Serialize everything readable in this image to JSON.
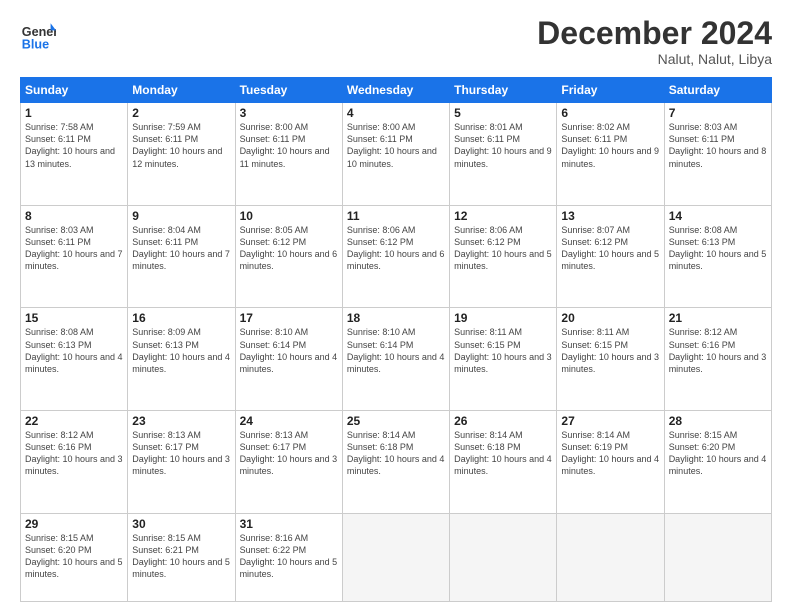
{
  "logo": {
    "line1": "General",
    "line2": "Blue"
  },
  "title": "December 2024",
  "subtitle": "Nalut, Nalut, Libya",
  "days_of_week": [
    "Sunday",
    "Monday",
    "Tuesday",
    "Wednesday",
    "Thursday",
    "Friday",
    "Saturday"
  ],
  "weeks": [
    [
      {
        "day": 1,
        "sunrise": "7:58 AM",
        "sunset": "6:11 PM",
        "daylight": "10 hours and 13 minutes."
      },
      {
        "day": 2,
        "sunrise": "7:59 AM",
        "sunset": "6:11 PM",
        "daylight": "10 hours and 12 minutes."
      },
      {
        "day": 3,
        "sunrise": "8:00 AM",
        "sunset": "6:11 PM",
        "daylight": "10 hours and 11 minutes."
      },
      {
        "day": 4,
        "sunrise": "8:00 AM",
        "sunset": "6:11 PM",
        "daylight": "10 hours and 10 minutes."
      },
      {
        "day": 5,
        "sunrise": "8:01 AM",
        "sunset": "6:11 PM",
        "daylight": "10 hours and 9 minutes."
      },
      {
        "day": 6,
        "sunrise": "8:02 AM",
        "sunset": "6:11 PM",
        "daylight": "10 hours and 9 minutes."
      },
      {
        "day": 7,
        "sunrise": "8:03 AM",
        "sunset": "6:11 PM",
        "daylight": "10 hours and 8 minutes."
      }
    ],
    [
      {
        "day": 8,
        "sunrise": "8:03 AM",
        "sunset": "6:11 PM",
        "daylight": "10 hours and 7 minutes."
      },
      {
        "day": 9,
        "sunrise": "8:04 AM",
        "sunset": "6:11 PM",
        "daylight": "10 hours and 7 minutes."
      },
      {
        "day": 10,
        "sunrise": "8:05 AM",
        "sunset": "6:12 PM",
        "daylight": "10 hours and 6 minutes."
      },
      {
        "day": 11,
        "sunrise": "8:06 AM",
        "sunset": "6:12 PM",
        "daylight": "10 hours and 6 minutes."
      },
      {
        "day": 12,
        "sunrise": "8:06 AM",
        "sunset": "6:12 PM",
        "daylight": "10 hours and 5 minutes."
      },
      {
        "day": 13,
        "sunrise": "8:07 AM",
        "sunset": "6:12 PM",
        "daylight": "10 hours and 5 minutes."
      },
      {
        "day": 14,
        "sunrise": "8:08 AM",
        "sunset": "6:13 PM",
        "daylight": "10 hours and 5 minutes."
      }
    ],
    [
      {
        "day": 15,
        "sunrise": "8:08 AM",
        "sunset": "6:13 PM",
        "daylight": "10 hours and 4 minutes."
      },
      {
        "day": 16,
        "sunrise": "8:09 AM",
        "sunset": "6:13 PM",
        "daylight": "10 hours and 4 minutes."
      },
      {
        "day": 17,
        "sunrise": "8:10 AM",
        "sunset": "6:14 PM",
        "daylight": "10 hours and 4 minutes."
      },
      {
        "day": 18,
        "sunrise": "8:10 AM",
        "sunset": "6:14 PM",
        "daylight": "10 hours and 4 minutes."
      },
      {
        "day": 19,
        "sunrise": "8:11 AM",
        "sunset": "6:15 PM",
        "daylight": "10 hours and 3 minutes."
      },
      {
        "day": 20,
        "sunrise": "8:11 AM",
        "sunset": "6:15 PM",
        "daylight": "10 hours and 3 minutes."
      },
      {
        "day": 21,
        "sunrise": "8:12 AM",
        "sunset": "6:16 PM",
        "daylight": "10 hours and 3 minutes."
      }
    ],
    [
      {
        "day": 22,
        "sunrise": "8:12 AM",
        "sunset": "6:16 PM",
        "daylight": "10 hours and 3 minutes."
      },
      {
        "day": 23,
        "sunrise": "8:13 AM",
        "sunset": "6:17 PM",
        "daylight": "10 hours and 3 minutes."
      },
      {
        "day": 24,
        "sunrise": "8:13 AM",
        "sunset": "6:17 PM",
        "daylight": "10 hours and 3 minutes."
      },
      {
        "day": 25,
        "sunrise": "8:14 AM",
        "sunset": "6:18 PM",
        "daylight": "10 hours and 4 minutes."
      },
      {
        "day": 26,
        "sunrise": "8:14 AM",
        "sunset": "6:18 PM",
        "daylight": "10 hours and 4 minutes."
      },
      {
        "day": 27,
        "sunrise": "8:14 AM",
        "sunset": "6:19 PM",
        "daylight": "10 hours and 4 minutes."
      },
      {
        "day": 28,
        "sunrise": "8:15 AM",
        "sunset": "6:20 PM",
        "daylight": "10 hours and 4 minutes."
      }
    ],
    [
      {
        "day": 29,
        "sunrise": "8:15 AM",
        "sunset": "6:20 PM",
        "daylight": "10 hours and 5 minutes."
      },
      {
        "day": 30,
        "sunrise": "8:15 AM",
        "sunset": "6:21 PM",
        "daylight": "10 hours and 5 minutes."
      },
      {
        "day": 31,
        "sunrise": "8:16 AM",
        "sunset": "6:22 PM",
        "daylight": "10 hours and 5 minutes."
      },
      null,
      null,
      null,
      null
    ]
  ]
}
